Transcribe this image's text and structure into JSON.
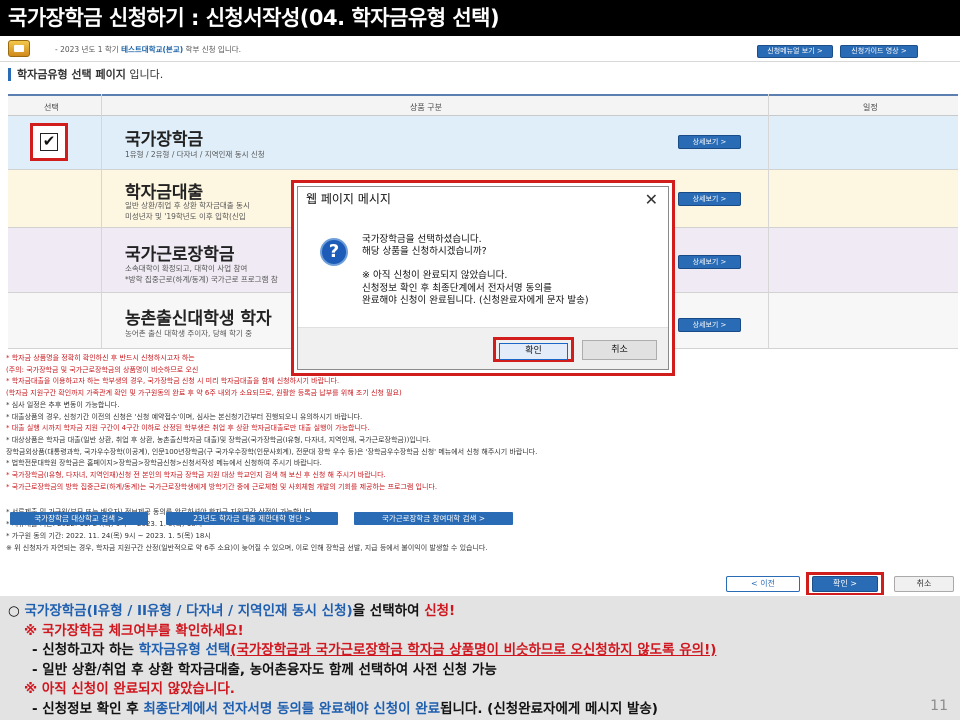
{
  "slide": {
    "title": "국가장학금 신청하기 : 신청서작성(04. 학자금유형 선택)",
    "page_number": "11"
  },
  "topbar": {
    "prefix": "- 2023 년도 1 학기",
    "school": "테스트대학교(본교)",
    "suffix": "학부 신청 입니다.",
    "menu_button": "신청메뉴얼 보기  >",
    "guide_button": "신청가이드 영상  >"
  },
  "page_heading": {
    "bold": "학자금유형 선택 페이지",
    "rest": " 입니다."
  },
  "table": {
    "col_select": "선택",
    "col_product": "상품 구분",
    "col_schedule": "일정"
  },
  "products": [
    {
      "title": "국가장학금",
      "desc1": "1유형 / 2유형 / 다자녀 / 지역인재 동시 신청",
      "desc2": "",
      "detail": "상세보기  >",
      "checked": true
    },
    {
      "title": "학자금대출",
      "desc1": "일반 상환/취업 후 상환 학자금대출 동시",
      "desc2": "미성년자 및 '19학년도 이후 입학(신입",
      "detail": "상세보기  >",
      "checked": false
    },
    {
      "title": "국가근로장학금",
      "desc1": "소속대학이 확정되고, 대학이 사업 참여",
      "desc2": "*방학 집중근로(하계/동계) 국가근로 프로그램 참",
      "detail": "상세보기  >",
      "checked": false
    },
    {
      "title": "농촌출신대학생 학자",
      "desc1": "농어촌 출신 대학생 주이자, 당해 학기 중",
      "desc2": "",
      "detail": "상세보기  >",
      "checked": false
    }
  ],
  "notes": [
    "* 학자금 상품명을 정확히 확인하신 후 반드시 신청하시고자 하는",
    "(주의: 국가장학금 및 국가근로장학금의 상품명이 비슷하므로 오신",
    "* 학자금대출을 이용하고자 하는 학부생의 경우, 국가장학금 신청 시 미리 학자금대출을 함께 신청하시기 바랍니다.",
    "(학자금 지원구간 확인까지 가족관계 확인 및 가구원동의 완료 후 약 6주 내외가 소요되므로, 원활한 등록금 납부를 위해 조기 신청 필요)",
    "* 심사 일정은 추후 변동이 가능합니다.",
    "* 대출상품의 경우, 신청기간 이전의 신청은 '신청 예약접수'이며, 심사는 본신청기간부터 진행되오니 유의하시기 바랍니다.",
    "* 대출 실행 시까지 학자금 지원 구간이 4구간 이하로 산정된 학부생은 취업 후 상환 학자금대출로만 대출 실행이 가능합니다.",
    "* 대상상품은 학자금 대출(일반 상환, 취업 후 상환, 농촌출신학자금 대출)및 장학금(국가장학금(I유형, 다자녀, 지역인재, 국가근로장학금))입니다.",
    "  장학금외상품(대통령과학, 국가우수장학(이공계), 인문100년장학금(구 국가우수장학(인문사회계), 전문대 장학 우수 등)은 '장학금우수장학금 신청' 메뉴에서 신청 해주시기 바랍니다.",
    "* 법학전문대학원 장학금은 홈페이지>장학금>장학금신청>신청서작성 메뉴에서 신청하여 주시기 바랍니다.",
    "* 국가장학금(I유형, 다자녀, 지역인재)신청 전 본인의 학자금 장학금 지원 대상 학교인지 검색 해 보신 후 신청 해 주시기 바랍니다.",
    "* 국가근로장학금의 방학 집중근로(하계/동계)는 국가근로장학생에게 방학기간 중에 근로체험 및 사회체험 개발의 기회를 제공하는 프로그램 입니다.",
    "* 서류제출 및 가구원(부모 또는 배우자) 정보제공 동의를 완료하셔야 학자금 지원구간 산정이 가능합니다.",
    "* 서류제출 기간: 2022. 11. 24(목) 9시 ~ 2023. 1. 5(목) 18시",
    "* 가구원 동의 기간: 2022. 11. 24(목) 9시 ~ 2023. 1. 5(목) 18시",
    "※ 위 신청자가 자연되는 경우, 학자금 지원구간 산정(일반적으로 약 6주 소요)이 늦어질 수 있으며, 이로 인해 장학금 선발, 지급 등에서 불이익이 발생할 수 있습니다."
  ],
  "link_buttons": {
    "search": "국가장학금 대상학교 검색  >",
    "restricted": "23년도 학자금 대출 제한대학 명단  >",
    "work": "국가근로장학금 참여대학 검색  >"
  },
  "nav": {
    "prev": "<  이전",
    "confirm": "확인  >",
    "cancel": "취소"
  },
  "dialog": {
    "title": "웹 페이지 메시지",
    "close": "✕",
    "icon": "?",
    "lines": [
      "국가장학금을 선택하셨습니다.",
      "해당 상품을 신청하시겠습니까?",
      "",
      "※ 아직 신청이 완료되지 않았습니다.",
      "신청정보 확인 후 최종단계에서 전자서명 동의를",
      "완료해야 신청이 완료됩니다. (신청완료자에게 문자 발송)"
    ],
    "ok": "확인",
    "cancel": "취소"
  },
  "instructions": {
    "l1_a": "○ ",
    "l1_b": "국가장학금(I유형 / II유형 / 다자녀 / 지역인재 동시 신청)",
    "l1_c": "을 선택하여 ",
    "l1_d": "신청!",
    "l2": "※ 국가장학금 체크여부를 확인하세요!",
    "l3_a": "- 신청하고자 하는 ",
    "l3_b": "학자금유형 선택",
    "l3_c": "(국가장학금과 국가근로장학금 학자금 상품명이 비슷하므로 오신청하지 않도록 유의!)",
    "l4": "- 일반 상환/취업 후 상환 학자금대출, 농어촌융자도 함께 선택하여 사전 신청 가능",
    "l5": "※ 아직 신청이 완료되지 않았습니다.",
    "l6_a": "- 신청정보 확인 후 ",
    "l6_b": "최종단계에서 전자서명 동의를 완료해야 신청이 완료",
    "l6_c": "됩니다. (신청완료자에게 메시지 발송)"
  },
  "colors": {
    "accent_blue": "#2a6bb5",
    "highlight_red": "#d21d1d",
    "instr_blue": "#1f5fb0",
    "instr_red": "#d0161e"
  }
}
